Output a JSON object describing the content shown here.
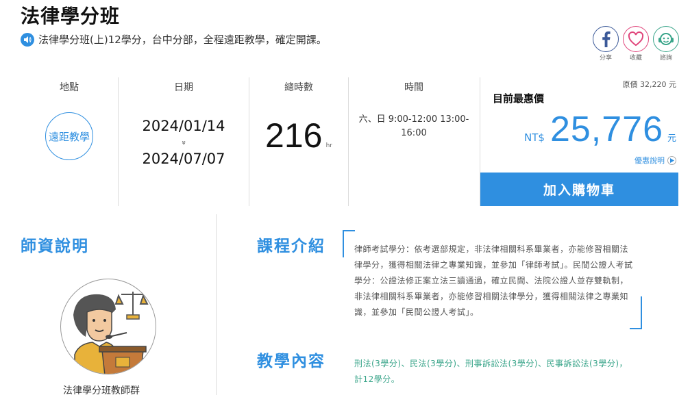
{
  "header": {
    "title": "法律學分班",
    "subtitle": "法律學分班(上)12學分，台中分部，全程遠距教學，確定開課。"
  },
  "share": [
    {
      "label": "分享",
      "icon": "facebook-icon",
      "color": "#3b5998"
    },
    {
      "label": "收藏",
      "icon": "heart-icon",
      "color": "#e0457b"
    },
    {
      "label": "諮詢",
      "icon": "consult-icon",
      "color": "#3aa58a"
    }
  ],
  "info": {
    "location": {
      "header": "地點",
      "value": "遠距教學"
    },
    "date": {
      "header": "日期",
      "start": "2024/01/14",
      "arrow": "»",
      "end": "2024/07/07"
    },
    "hours": {
      "header": "總時數",
      "value": "216",
      "unit": "hr"
    },
    "time": {
      "header": "時間",
      "value": "六、日 9:00-12:00 13:00-16:00"
    }
  },
  "price": {
    "original": "原價 32,220 元",
    "best_label": "目前最惠價",
    "currency": "NT$",
    "value": "25,776",
    "unit": "元",
    "discount_link": "優惠說明",
    "cart_button": "加入購物車"
  },
  "teachers": {
    "title": "師資說明",
    "name": "法律學分班教師群"
  },
  "intro": {
    "title": "課程介紹",
    "text": "律師考試學分：依考選部規定，非法律相關科系畢業者，亦能修習相關法律學分，獲得相關法律之專業知識，並參加「律師考試」。民間公證人考試學分：公證法修正案立法三讀通過，確立民間、法院公證人並存雙軌制，非法律相關科系畢業者，亦能修習相關法律學分，獲得相關法律之專業知識，並參加「民間公證人考試」。"
  },
  "content": {
    "title": "教學內容",
    "text": "刑法(3學分)、民法(3學分)、刑事訴訟法(3學分)、民事訴訟法(3學分)，計12學分。"
  },
  "colors": {
    "accent": "#2f8fe0",
    "green": "#3aa58a"
  }
}
